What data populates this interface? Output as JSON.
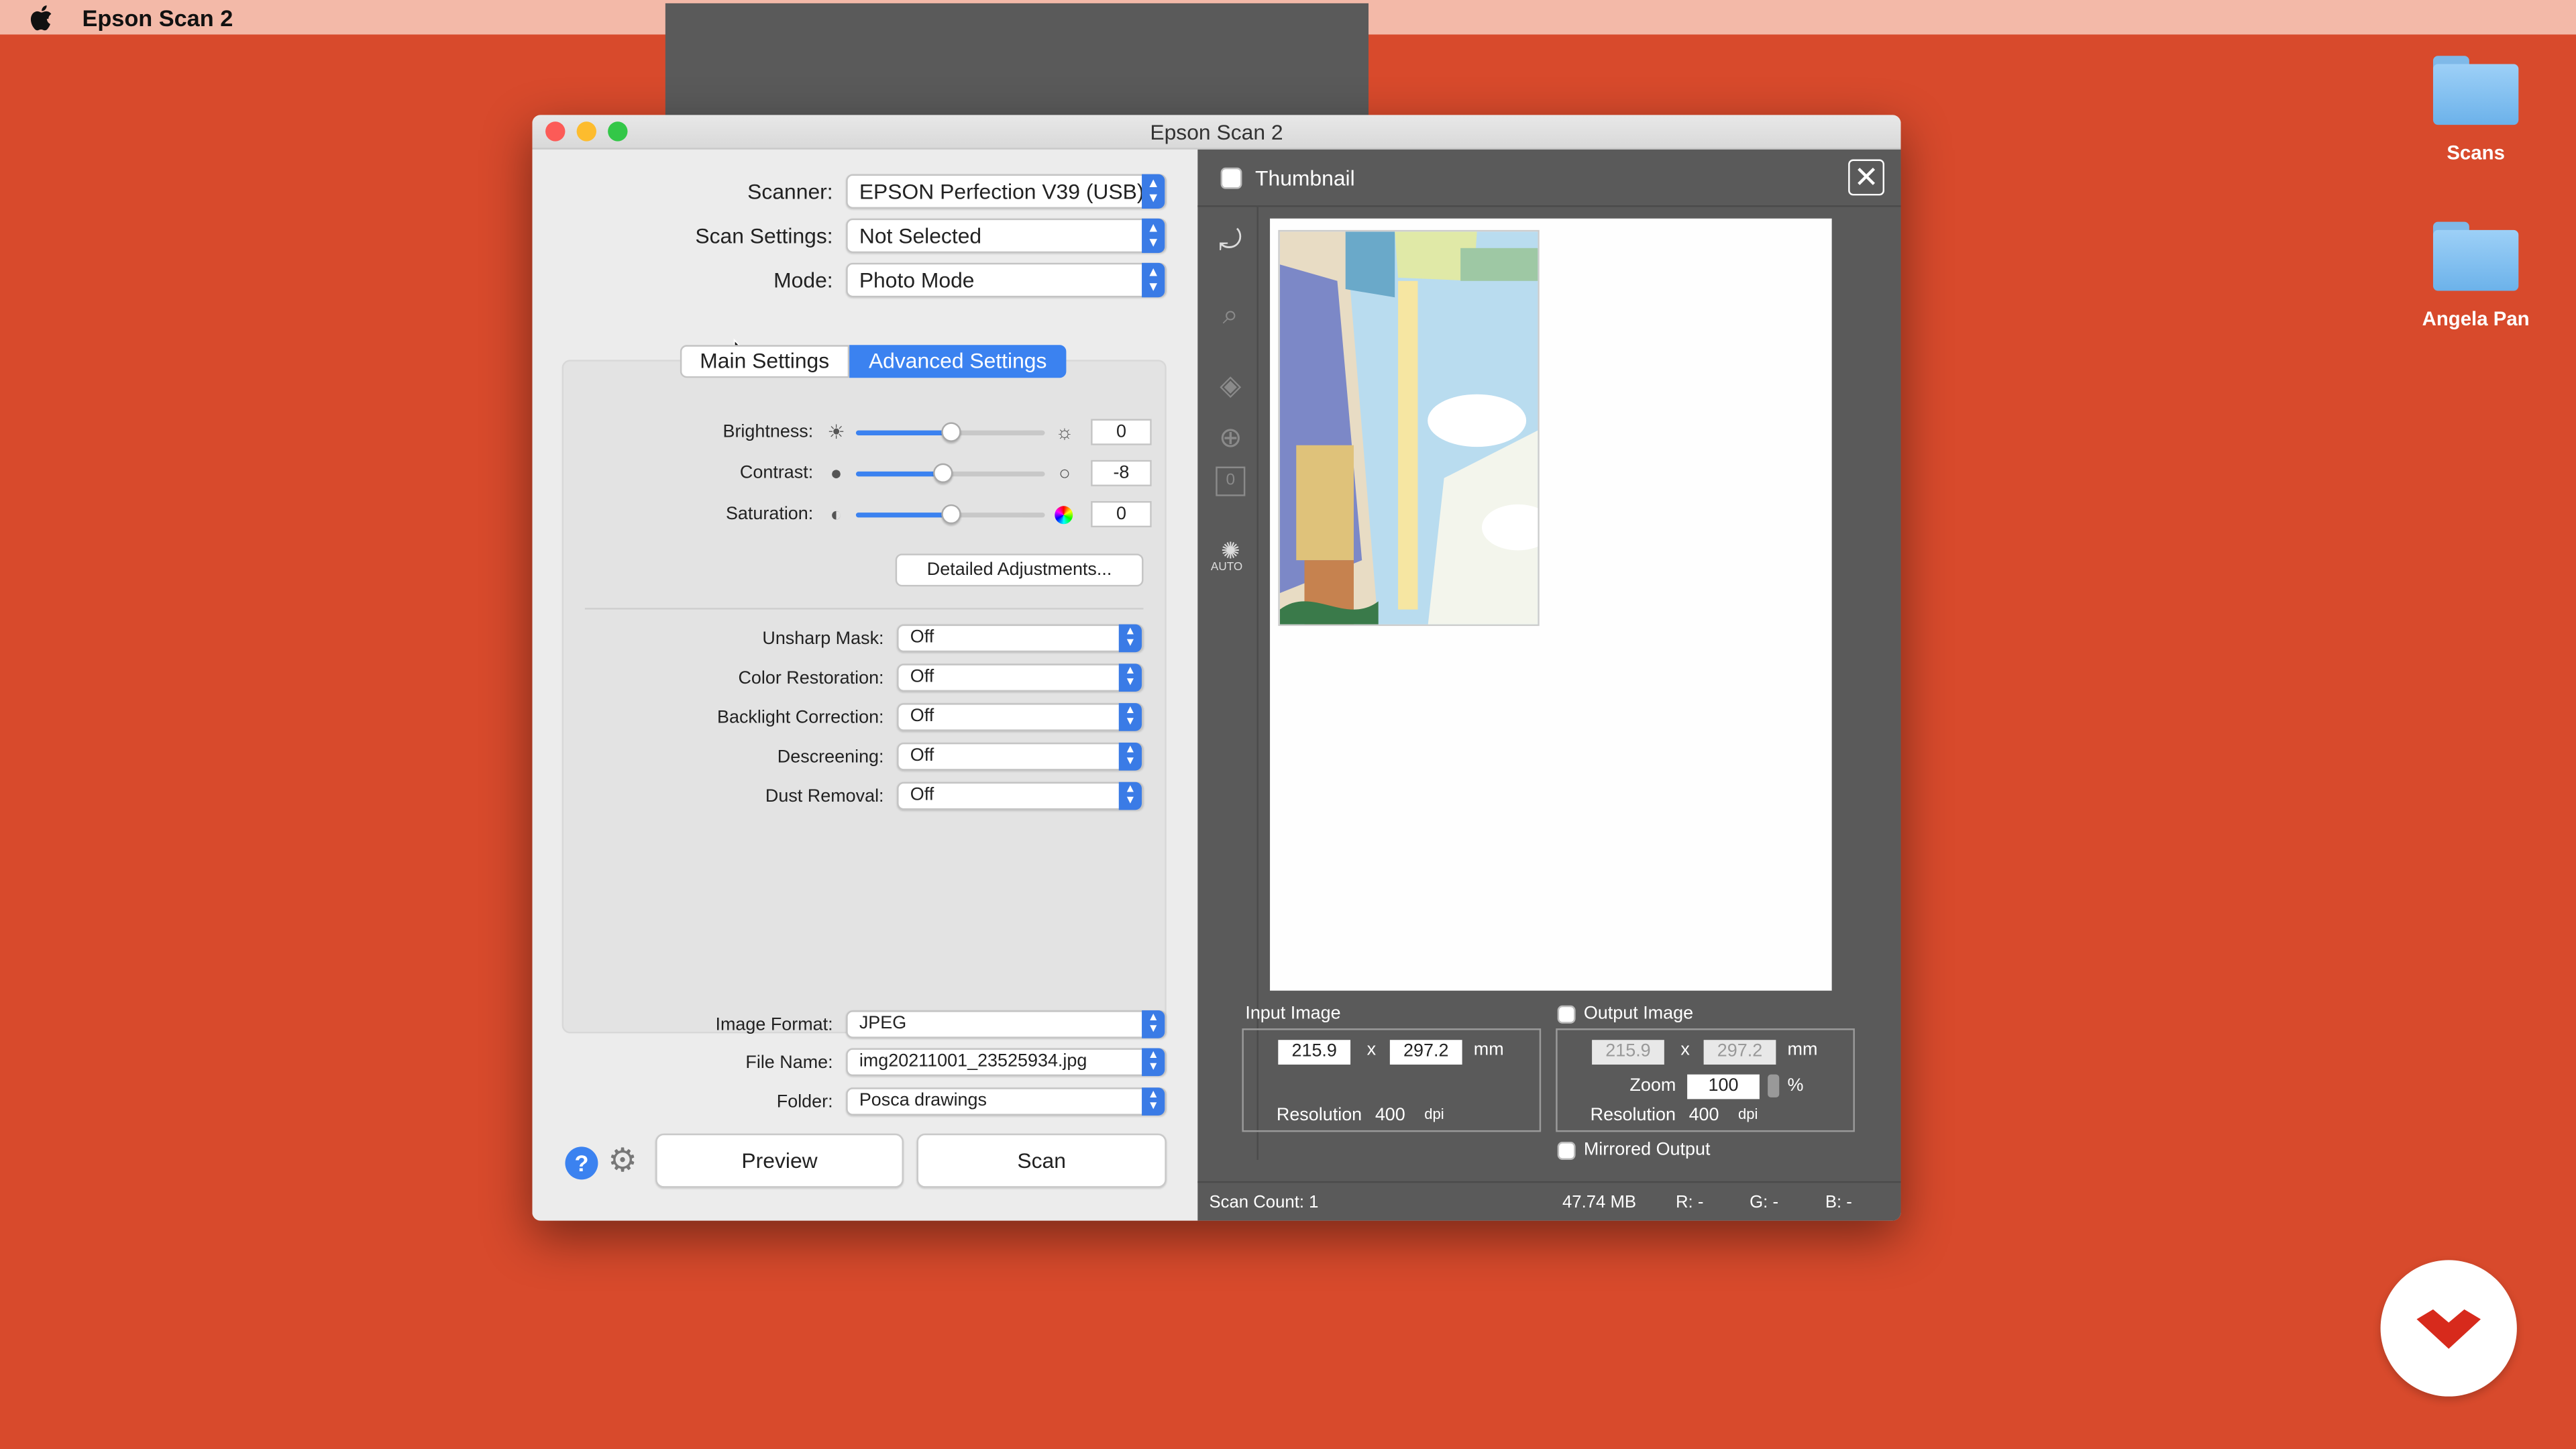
{
  "menubar": {
    "app_name": "Epson Scan 2",
    "status_icons": [
      "creative-cloud-icon",
      "adobe-cc-icon",
      "stack-icon",
      "bluetooth-icon",
      "wifi-icon",
      "airplay-icon",
      "volume-icon",
      "time-machine-icon",
      "flag-canada-icon",
      "spotlight-icon",
      "notification-center-icon"
    ]
  },
  "desktop": {
    "icons": [
      {
        "label": "Scans"
      },
      {
        "label": "Angela Pan"
      }
    ]
  },
  "window": {
    "title": "Epson Scan 2",
    "scanner_label": "Scanner:",
    "scanner_value": "EPSON Perfection V39 (USB)",
    "scan_settings_label": "Scan Settings:",
    "scan_settings_value": "Not Selected",
    "mode_label": "Mode:",
    "mode_value": "Photo Mode",
    "tabs": [
      {
        "label": "Main Settings",
        "active": false
      },
      {
        "label": "Advanced Settings",
        "active": true
      }
    ],
    "adjust": {
      "brightness_label": "Brightness:",
      "brightness_value": "0",
      "brightness_level": 0.5,
      "contrast_label": "Contrast:",
      "contrast_value": "-8",
      "contrast_level": 0.46,
      "saturation_label": "Saturation:",
      "saturation_value": "0",
      "saturation_level": 0.5,
      "detailed_button": "Detailed Adjustments..."
    },
    "options": [
      {
        "label": "Unsharp Mask:",
        "value": "Off"
      },
      {
        "label": "Color Restoration:",
        "value": "Off"
      },
      {
        "label": "Backlight Correction:",
        "value": "Off"
      },
      {
        "label": "Descreening:",
        "value": "Off"
      },
      {
        "label": "Dust Removal:",
        "value": "Off"
      }
    ],
    "image_format_label": "Image Format:",
    "image_format_value": "JPEG",
    "file_name_label": "File Name:",
    "file_name_value": "img20211001_23525934.jpg",
    "folder_label": "Folder:",
    "folder_value": "Posca drawings",
    "preview_button": "Preview",
    "scan_button": "Scan"
  },
  "thumbnail_panel": {
    "title": "Thumbnail",
    "input_image_label": "Input Image",
    "input_width": "215.9",
    "input_height": "297.2",
    "x_symbol": "x",
    "unit_mm": "mm",
    "resolution_label": "Resolution",
    "resolution_value": "400",
    "dpi_label": "dpi",
    "output_image_label": "Output Image",
    "output_width": "215.9",
    "output_height": "297.2",
    "zoom_label": "Zoom",
    "zoom_value": "100",
    "percent": "%",
    "mirrored_output_label": "Mirrored Output",
    "tool_auto_label": "AUTO",
    "tool_count": "0"
  },
  "statusbar": {
    "scan_count": "Scan Count: 1",
    "size": "47.74 MB",
    "r": "R:  -",
    "g": "G:  -",
    "b": "B:  -"
  },
  "colors": {
    "desktop": "#d84a2c",
    "accent": "#3b82f0",
    "panel_dark": "#5a5a5a"
  }
}
